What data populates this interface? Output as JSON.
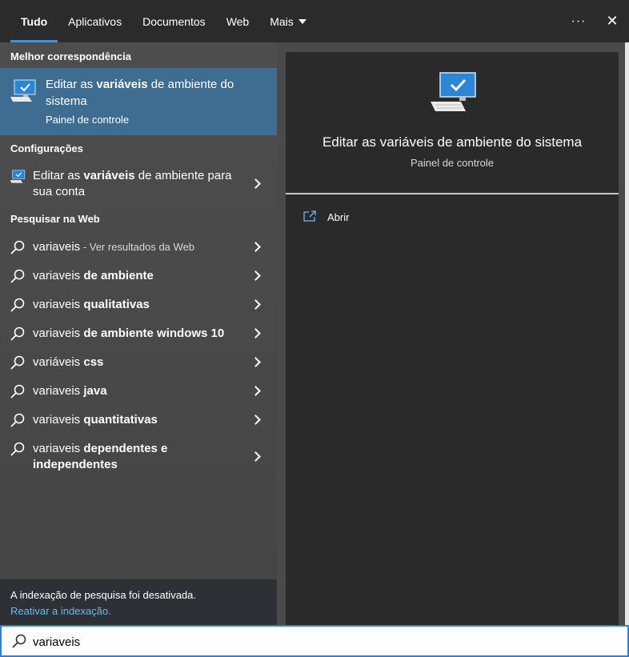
{
  "tabs": [
    {
      "label": "Tudo"
    },
    {
      "label": "Aplicativos"
    },
    {
      "label": "Documentos"
    },
    {
      "label": "Web"
    },
    {
      "label": "Mais"
    }
  ],
  "top_actions": {
    "more": "···",
    "close": "✕"
  },
  "left": {
    "best_match_title": "Melhor correspondência",
    "best_match": {
      "title_pre": "Editar as ",
      "title_bold": "variáveis",
      "title_post": " de ambiente do sistema",
      "subtitle": "Painel de controle"
    },
    "settings_title": "Configurações",
    "settings_item": {
      "pre": "Editar as ",
      "bold": "variáveis",
      "post": " de ambiente para sua conta"
    },
    "web_title": "Pesquisar na Web",
    "web_items": [
      {
        "pre": "variaveis",
        "bold": "",
        "hint": " - Ver resultados da Web"
      },
      {
        "pre": "variaveis ",
        "bold": "de ambiente",
        "hint": ""
      },
      {
        "pre": "variaveis ",
        "bold": "qualitativas",
        "hint": ""
      },
      {
        "pre": "variaveis ",
        "bold": "de ambiente windows 10",
        "hint": ""
      },
      {
        "pre": "variáveis ",
        "bold": "css",
        "hint": ""
      },
      {
        "pre": "variaveis ",
        "bold": "java",
        "hint": ""
      },
      {
        "pre": "variaveis ",
        "bold": "quantitativas",
        "hint": ""
      },
      {
        "pre": "variaveis ",
        "bold": "dependentes e independentes",
        "hint": ""
      }
    ],
    "index_message": "A indexação de pesquisa foi desativada.",
    "index_link": "Reativar a indexação."
  },
  "detail": {
    "title": "Editar as variáveis de ambiente do sistema",
    "subtitle": "Painel de controle",
    "actions": [
      {
        "label": "Abrir"
      }
    ]
  },
  "search": {
    "value": "variaveis"
  },
  "colors": {
    "accent": "#3a95de",
    "selected_bg": "#3f6d92",
    "link": "#6fb6ef"
  }
}
